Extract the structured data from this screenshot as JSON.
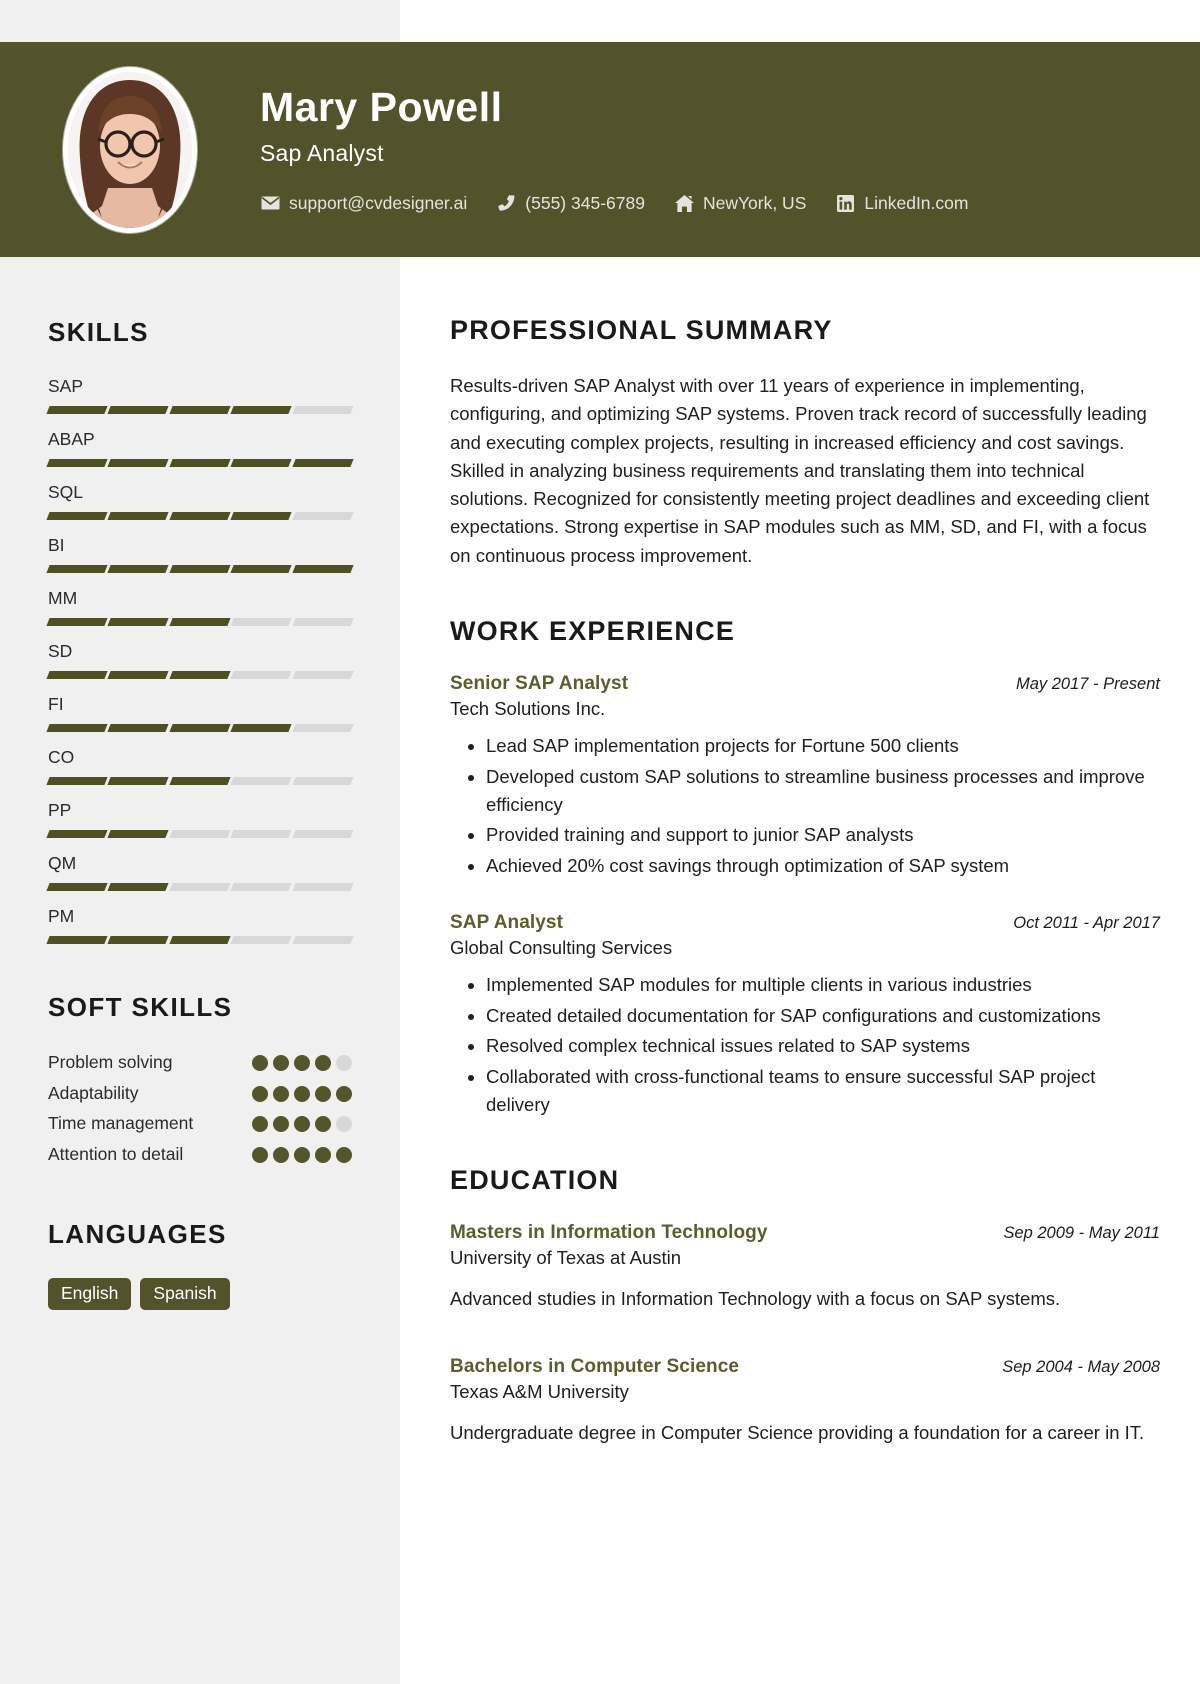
{
  "theme": {
    "accent_dark_green": "#52532b",
    "accent_text_green": "#5b5d2c",
    "sidebar_bg": "#f0f0f0",
    "segment_off": "#d8d8d8",
    "page_bg": "#ffffff"
  },
  "header": {
    "name": "Mary Powell",
    "job_title": "Sap Analyst",
    "avatar_alt": "profile-photo",
    "contacts": [
      {
        "icon": "envelope-icon",
        "label": "support@cvdesigner.ai"
      },
      {
        "icon": "phone-icon",
        "label": "(555) 345-6789"
      },
      {
        "icon": "home-icon",
        "label": "NewYork, US"
      },
      {
        "icon": "linkedin-icon",
        "label": "LinkedIn.com"
      }
    ]
  },
  "sidebar": {
    "skills_heading": "SKILLS",
    "skills_max": 5,
    "skills": [
      {
        "name": "SAP",
        "level": 4
      },
      {
        "name": "ABAP",
        "level": 5
      },
      {
        "name": "SQL",
        "level": 4
      },
      {
        "name": "BI",
        "level": 5
      },
      {
        "name": "MM",
        "level": 3
      },
      {
        "name": "SD",
        "level": 3
      },
      {
        "name": "FI",
        "level": 4
      },
      {
        "name": "CO",
        "level": 3
      },
      {
        "name": "PP",
        "level": 2
      },
      {
        "name": "QM",
        "level": 2
      },
      {
        "name": "PM",
        "level": 3
      }
    ],
    "soft_skills_heading": "SOFT SKILLS",
    "soft_skills_max": 5,
    "soft_skills": [
      {
        "name": "Problem solving",
        "level": 4
      },
      {
        "name": "Adaptability",
        "level": 5
      },
      {
        "name": "Time management",
        "level": 4
      },
      {
        "name": "Attention to detail",
        "level": 5
      }
    ],
    "languages_heading": "LANGUAGES",
    "languages": [
      "English",
      "Spanish"
    ]
  },
  "main": {
    "summary_heading": "PROFESSIONAL SUMMARY",
    "summary_text": "Results-driven SAP Analyst with over 11 years of experience in implementing, configuring, and optimizing SAP systems. Proven track record of successfully leading and executing complex projects, resulting in increased efficiency and cost savings. Skilled in analyzing business requirements and translating them into technical solutions. Recognized for consistently meeting project deadlines and exceeding client expectations. Strong expertise in SAP modules such as MM, SD, and FI, with a focus on continuous process improvement.",
    "experience_heading": "WORK EXPERIENCE",
    "experience": [
      {
        "role": "Senior SAP Analyst",
        "date": "May 2017 - Present",
        "organization": "Tech Solutions Inc.",
        "bullets": [
          "Lead SAP implementation projects for Fortune 500 clients",
          "Developed custom SAP solutions to streamline business processes and improve efficiency",
          "Provided training and support to junior SAP analysts",
          "Achieved 20% cost savings through optimization of SAP system"
        ]
      },
      {
        "role": "SAP Analyst",
        "date": "Oct 2011 - Apr 2017",
        "organization": "Global Consulting Services",
        "bullets": [
          "Implemented SAP modules for multiple clients in various industries",
          "Created detailed documentation for SAP configurations and customizations",
          "Resolved complex technical issues related to SAP systems",
          "Collaborated with cross-functional teams to ensure successful SAP project delivery"
        ]
      }
    ],
    "education_heading": "EDUCATION",
    "education": [
      {
        "degree": "Masters in Information Technology",
        "date": "Sep 2009 - May 2011",
        "institution": "University of Texas at Austin",
        "description": "Advanced studies in Information Technology with a focus on SAP systems."
      },
      {
        "degree": "Bachelors in Computer Science",
        "date": "Sep 2004 - May 2008",
        "institution": "Texas A&M University",
        "description": "Undergraduate degree in Computer Science providing a foundation for a career in IT."
      }
    ]
  }
}
